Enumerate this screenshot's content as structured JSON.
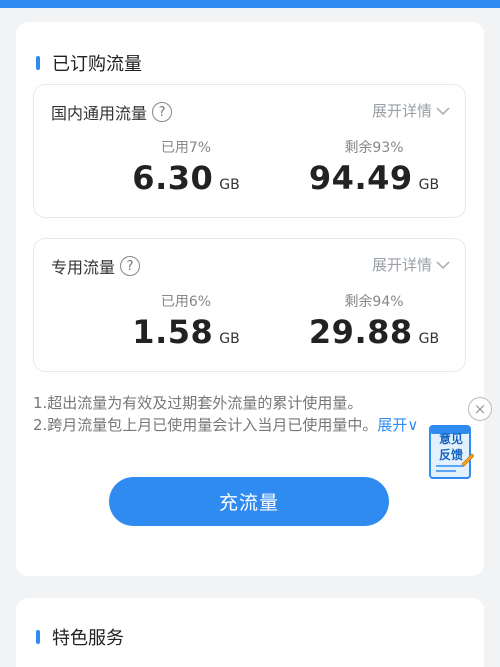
{
  "subscribed": {
    "title": "已订购流量",
    "domestic": {
      "title": "国内通用流量",
      "help": "?",
      "expand_label": "展开详情",
      "used_label": "已用7%",
      "used_value": "6.30",
      "used_unit": "GB",
      "remaining_label": "剩余93%",
      "remaining_value": "94.49",
      "remaining_unit": "GB"
    },
    "dedicated": {
      "title": "专用流量",
      "help": "?",
      "expand_label": "展开详情",
      "used_label": "已用6%",
      "used_value": "1.58",
      "used_unit": "GB",
      "remaining_label": "剩余94%",
      "remaining_value": "29.88",
      "remaining_unit": "GB"
    },
    "notes": {
      "line1": "1.超出流量为有效及过期套外流量的累计使用量。",
      "line2": "2.跨月流量包上月已使用量会计入当月已使用量中。",
      "line2_expand": "展开∨"
    },
    "recharge_label": "充流量"
  },
  "feedback": {
    "line1": "意见",
    "line2": "反馈",
    "close": "×"
  },
  "features": {
    "title": "特色服务"
  },
  "colors": {
    "accent": "#2f8bf0",
    "background": "#f2f3f5"
  }
}
